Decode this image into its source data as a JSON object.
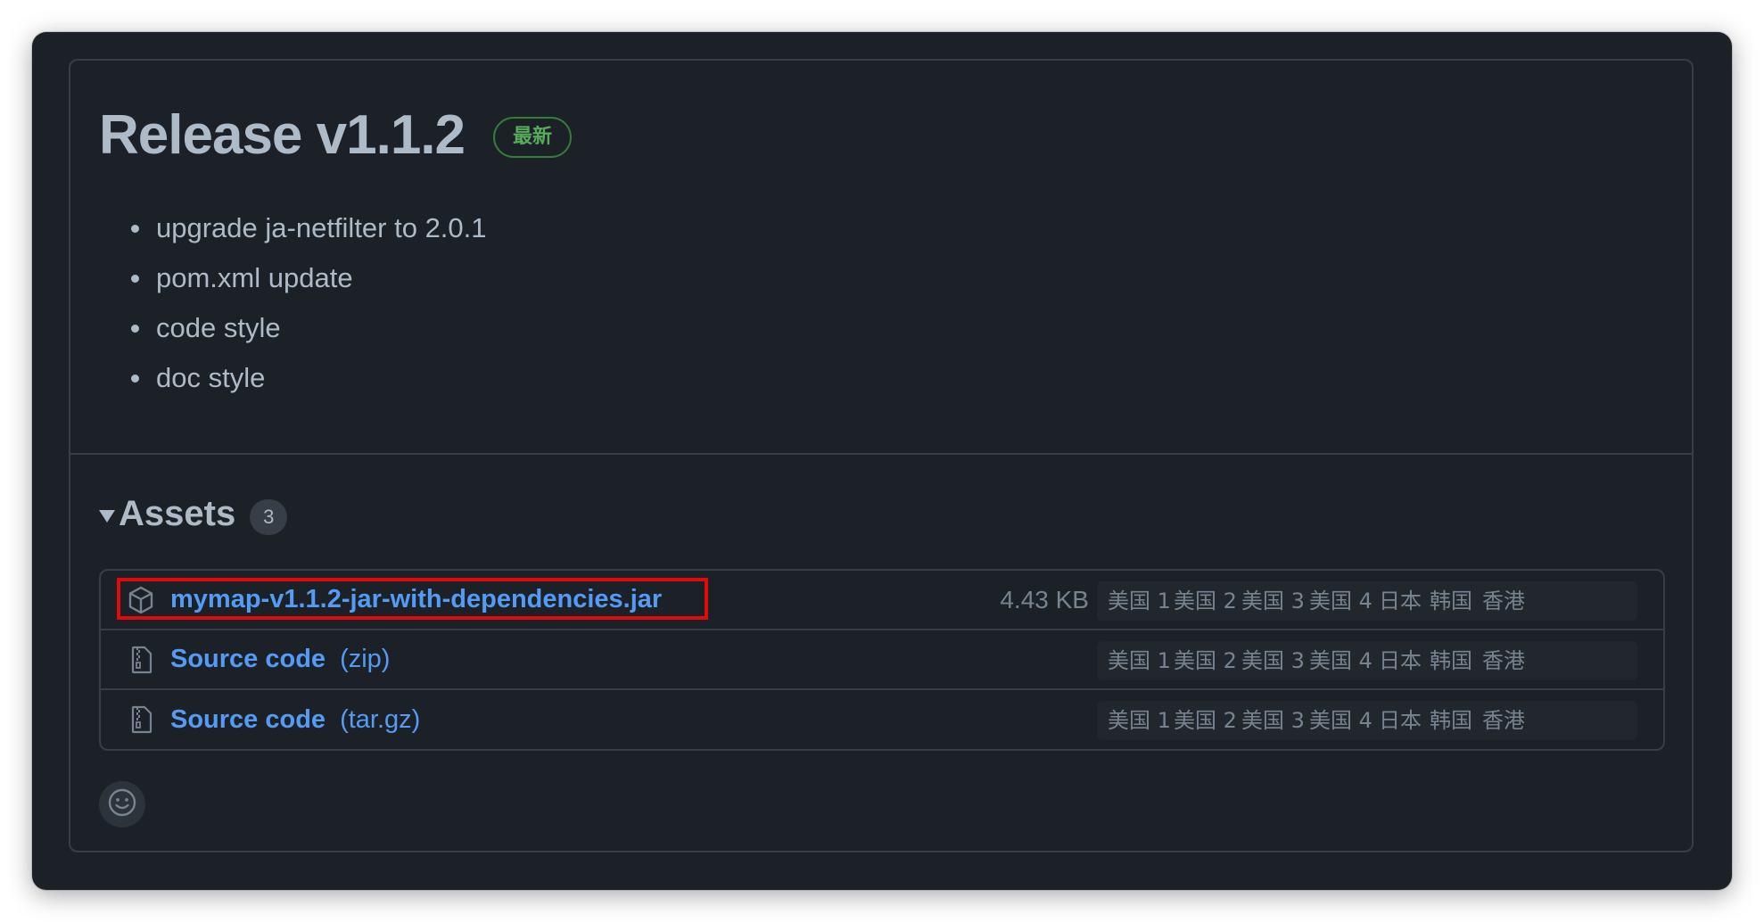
{
  "release": {
    "title": "Release v1.1.2",
    "latest_badge": "最新",
    "notes": [
      "upgrade ja-netfilter to 2.0.1",
      "pom.xml update",
      "code style",
      "doc style"
    ]
  },
  "assets": {
    "title": "Assets",
    "count": "3",
    "rows": [
      {
        "icon": "package-icon",
        "name": "mymap-v1.1.2-jar-with-dependencies.jar",
        "ext": "",
        "size": "4.43 KB",
        "mirrors": [
          "美国 1",
          "美国 2",
          "美国 3",
          "美国 4",
          "日本",
          "韩国",
          "香港"
        ]
      },
      {
        "icon": "file-zip-icon",
        "name": "Source code",
        "ext": "(zip)",
        "size": "",
        "mirrors": [
          "美国 1",
          "美国 2",
          "美国 3",
          "美国 4",
          "日本",
          "韩国",
          "香港"
        ]
      },
      {
        "icon": "file-zip-icon",
        "name": "Source code",
        "ext": "(tar.gz)",
        "size": "",
        "mirrors": [
          "美国 1",
          "美国 2",
          "美国 3",
          "美国 4",
          "日本",
          "韩国",
          "香港"
        ]
      }
    ]
  },
  "colors": {
    "background": "#1c2128",
    "border": "#373e47",
    "text": "#adbac7",
    "link": "#539bf5",
    "muted": "#768390",
    "latest_green": "#57ab5a",
    "highlight_red": "#e00a0a"
  },
  "reaction": {
    "icon": "smiley-icon"
  }
}
